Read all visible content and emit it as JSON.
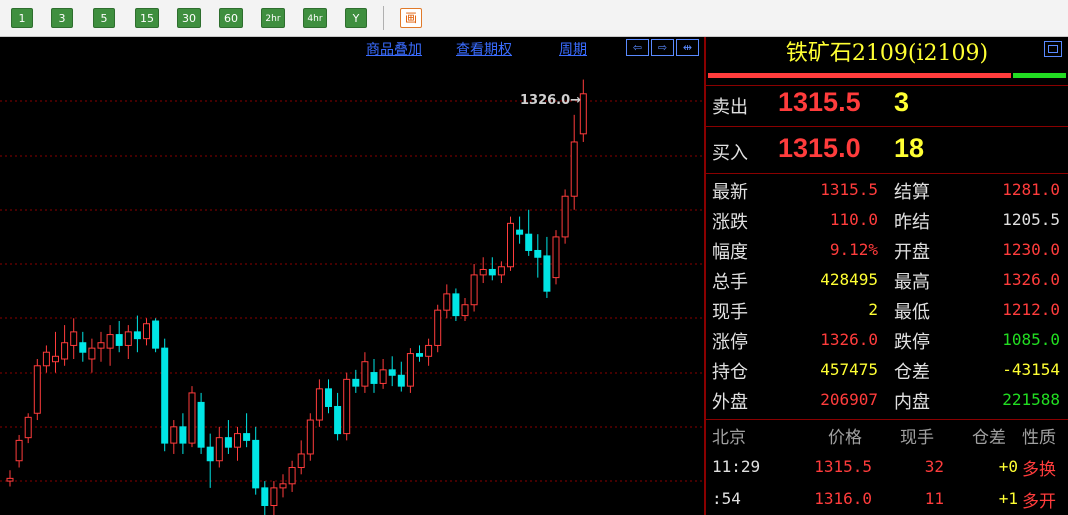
{
  "colors": {
    "up": "#ff3c3c",
    "down": "#00e6e6",
    "grid": "#8a0000",
    "yellow": "#ffff33",
    "green": "#22dd22",
    "white": "#e0e0e0"
  },
  "toolbar": {
    "periods": [
      "1",
      "3",
      "5",
      "15",
      "30",
      "60",
      "2hr",
      "4hr",
      "Y"
    ],
    "draw_icon": "画"
  },
  "chart": {
    "links": [
      "商品叠加",
      "查看期权",
      "周期"
    ],
    "nav_icons": [
      "arrow-left-icon",
      "arrow-right-icon",
      "expand-icon"
    ],
    "nav_glyphs": [
      "⇦",
      "⇨",
      "⇹"
    ],
    "high_label": "1326.0→"
  },
  "chart_data": {
    "type": "candlestick",
    "grid": "horizontal dotted",
    "ylim": [
      1005,
      1350
    ],
    "candles": [
      [
        1030,
        1038,
        1026,
        1032
      ],
      [
        1045,
        1064,
        1040,
        1060
      ],
      [
        1062,
        1080,
        1058,
        1077
      ],
      [
        1080,
        1120,
        1075,
        1115
      ],
      [
        1115,
        1130,
        1110,
        1125
      ],
      [
        1118,
        1140,
        1110,
        1122
      ],
      [
        1120,
        1145,
        1115,
        1132
      ],
      [
        1130,
        1150,
        1120,
        1140
      ],
      [
        1132,
        1140,
        1118,
        1125
      ],
      [
        1120,
        1135,
        1110,
        1128
      ],
      [
        1128,
        1140,
        1118,
        1132
      ],
      [
        1128,
        1145,
        1115,
        1138
      ],
      [
        1138,
        1148,
        1125,
        1130
      ],
      [
        1130,
        1145,
        1120,
        1140
      ],
      [
        1140,
        1152,
        1125,
        1135
      ],
      [
        1135,
        1150,
        1130,
        1146
      ],
      [
        1148,
        1150,
        1125,
        1128
      ],
      [
        1128,
        1135,
        1052,
        1058
      ],
      [
        1058,
        1075,
        1050,
        1070
      ],
      [
        1070,
        1080,
        1050,
        1058
      ],
      [
        1058,
        1100,
        1055,
        1095
      ],
      [
        1088,
        1095,
        1050,
        1055
      ],
      [
        1055,
        1065,
        1025,
        1045
      ],
      [
        1045,
        1070,
        1040,
        1062
      ],
      [
        1062,
        1075,
        1050,
        1055
      ],
      [
        1055,
        1070,
        1045,
        1065
      ],
      [
        1065,
        1080,
        1055,
        1060
      ],
      [
        1060,
        1070,
        1020,
        1025
      ],
      [
        1025,
        1030,
        1005,
        1012
      ],
      [
        1012,
        1030,
        1005,
        1025
      ],
      [
        1025,
        1035,
        1018,
        1028
      ],
      [
        1028,
        1045,
        1022,
        1040
      ],
      [
        1040,
        1060,
        1035,
        1050
      ],
      [
        1050,
        1080,
        1045,
        1075
      ],
      [
        1075,
        1105,
        1070,
        1098
      ],
      [
        1098,
        1105,
        1080,
        1085
      ],
      [
        1085,
        1095,
        1060,
        1065
      ],
      [
        1065,
        1110,
        1060,
        1105
      ],
      [
        1105,
        1112,
        1095,
        1100
      ],
      [
        1100,
        1125,
        1095,
        1118
      ],
      [
        1110,
        1120,
        1095,
        1102
      ],
      [
        1102,
        1120,
        1098,
        1112
      ],
      [
        1112,
        1122,
        1100,
        1108
      ],
      [
        1108,
        1118,
        1096,
        1100
      ],
      [
        1100,
        1128,
        1095,
        1124
      ],
      [
        1124,
        1130,
        1118,
        1122
      ],
      [
        1122,
        1135,
        1115,
        1130
      ],
      [
        1130,
        1160,
        1125,
        1156
      ],
      [
        1156,
        1175,
        1150,
        1168
      ],
      [
        1168,
        1172,
        1148,
        1152
      ],
      [
        1152,
        1165,
        1148,
        1160
      ],
      [
        1160,
        1190,
        1155,
        1182
      ],
      [
        1182,
        1195,
        1176,
        1186
      ],
      [
        1186,
        1195,
        1178,
        1182
      ],
      [
        1182,
        1192,
        1176,
        1188
      ],
      [
        1188,
        1225,
        1185,
        1220
      ],
      [
        1215,
        1225,
        1205,
        1212
      ],
      [
        1212,
        1230,
        1196,
        1200
      ],
      [
        1200,
        1212,
        1180,
        1195
      ],
      [
        1196,
        1210,
        1165,
        1170
      ],
      [
        1180,
        1215,
        1175,
        1210
      ],
      [
        1210,
        1245,
        1205,
        1240
      ],
      [
        1240,
        1300,
        1230,
        1280
      ],
      [
        1286,
        1326,
        1280,
        1315.5
      ]
    ]
  },
  "panel": {
    "title": "铁矿石2109(i2109)",
    "ratio": {
      "red": 0.845
    },
    "sell": {
      "label": "卖出",
      "price": "1315.5",
      "vol": "3"
    },
    "buy": {
      "label": "买入",
      "price": "1315.0",
      "vol": "18"
    },
    "stats": [
      {
        "l": "最新",
        "v": "1315.5",
        "vc": "up",
        "l2": "结算",
        "v2": "1281.0",
        "v2c": "up"
      },
      {
        "l": "涨跌",
        "v": "110.0",
        "vc": "up",
        "l2": "昨结",
        "v2": "1205.5",
        "v2c": "white"
      },
      {
        "l": "幅度",
        "v": "9.12%",
        "vc": "up",
        "l2": "开盘",
        "v2": "1230.0",
        "v2c": "up"
      },
      {
        "l": "总手",
        "v": "428495",
        "vc": "yellow",
        "l2": "最高",
        "v2": "1326.0",
        "v2c": "up"
      },
      {
        "l": "现手",
        "v": "2",
        "vc": "yellow",
        "l2": "最低",
        "v2": "1212.0",
        "v2c": "up"
      },
      {
        "l": "涨停",
        "v": "1326.0",
        "vc": "up",
        "l2": "跌停",
        "v2": "1085.0",
        "v2c": "green"
      },
      {
        "l": "持仓",
        "v": "457475",
        "vc": "yellow",
        "l2": "仓差",
        "v2": "-43154",
        "v2c": "yellow"
      },
      {
        "l": "外盘",
        "v": "206907",
        "vc": "up",
        "l2": "内盘",
        "v2": "221588",
        "v2c": "green"
      }
    ],
    "tick_headers": [
      "北京",
      "价格",
      "现手",
      "仓差",
      "性质"
    ],
    "ticks": [
      {
        "time": "11:29",
        "price": "1315.5",
        "vol": "32",
        "oi": "+0",
        "nature": "多换"
      },
      {
        "time": ":54",
        "price": "1316.0",
        "vol": "11",
        "oi": "+1",
        "nature": "多开"
      }
    ]
  }
}
